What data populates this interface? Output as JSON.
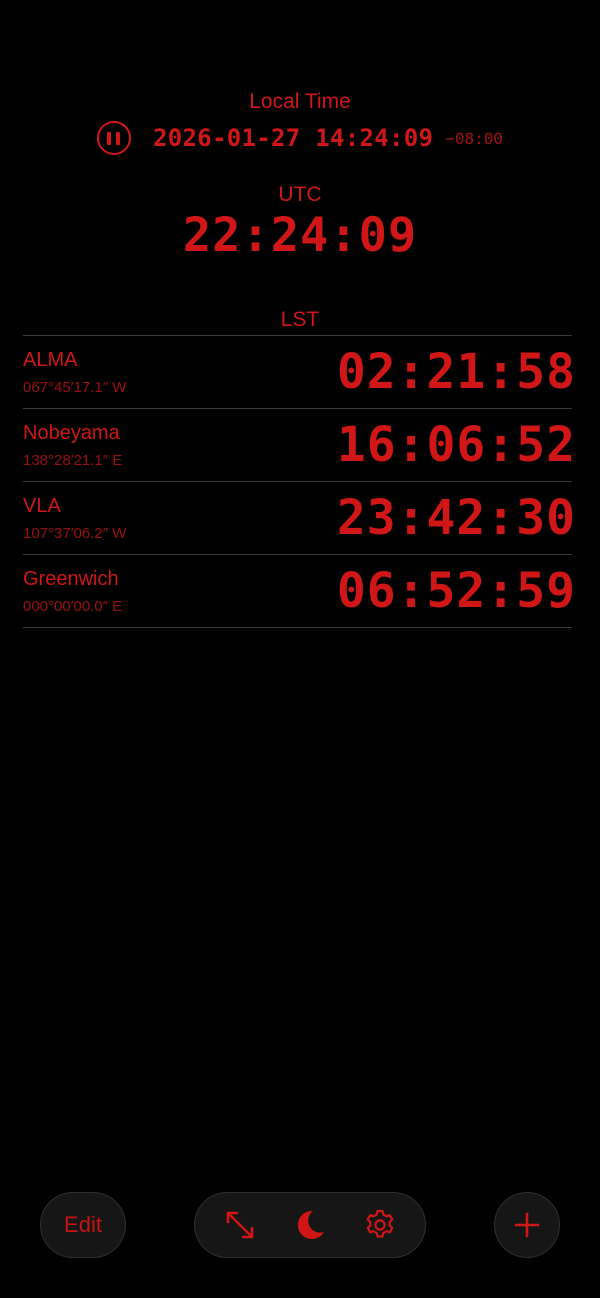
{
  "local": {
    "label": "Local Time",
    "datetime": "2026-01-27 14:24:09",
    "offset": "−08:00"
  },
  "utc": {
    "label": "UTC",
    "time": "22:24:09"
  },
  "lst": {
    "label": "LST",
    "sites": [
      {
        "name": "ALMA",
        "coord": "067°45′17.1″ W",
        "time": "02:21:58"
      },
      {
        "name": "Nobeyama",
        "coord": "138°28′21.1″ E",
        "time": "16:06:52"
      },
      {
        "name": "VLA",
        "coord": "107°37′06.2″ W",
        "time": "23:42:30"
      },
      {
        "name": "Greenwich",
        "coord": "000°00′00.0″ E",
        "time": "06:52:59"
      }
    ]
  },
  "toolbar": {
    "edit_label": "Edit",
    "icons": [
      "pause-icon",
      "expand-icon",
      "moon-icon",
      "gear-icon",
      "plus-icon"
    ]
  },
  "colors": {
    "accent": "#d01616",
    "dim": "#9a1010",
    "background": "#000000",
    "divider": "#3a3a3a",
    "button_bg": "#161616"
  }
}
